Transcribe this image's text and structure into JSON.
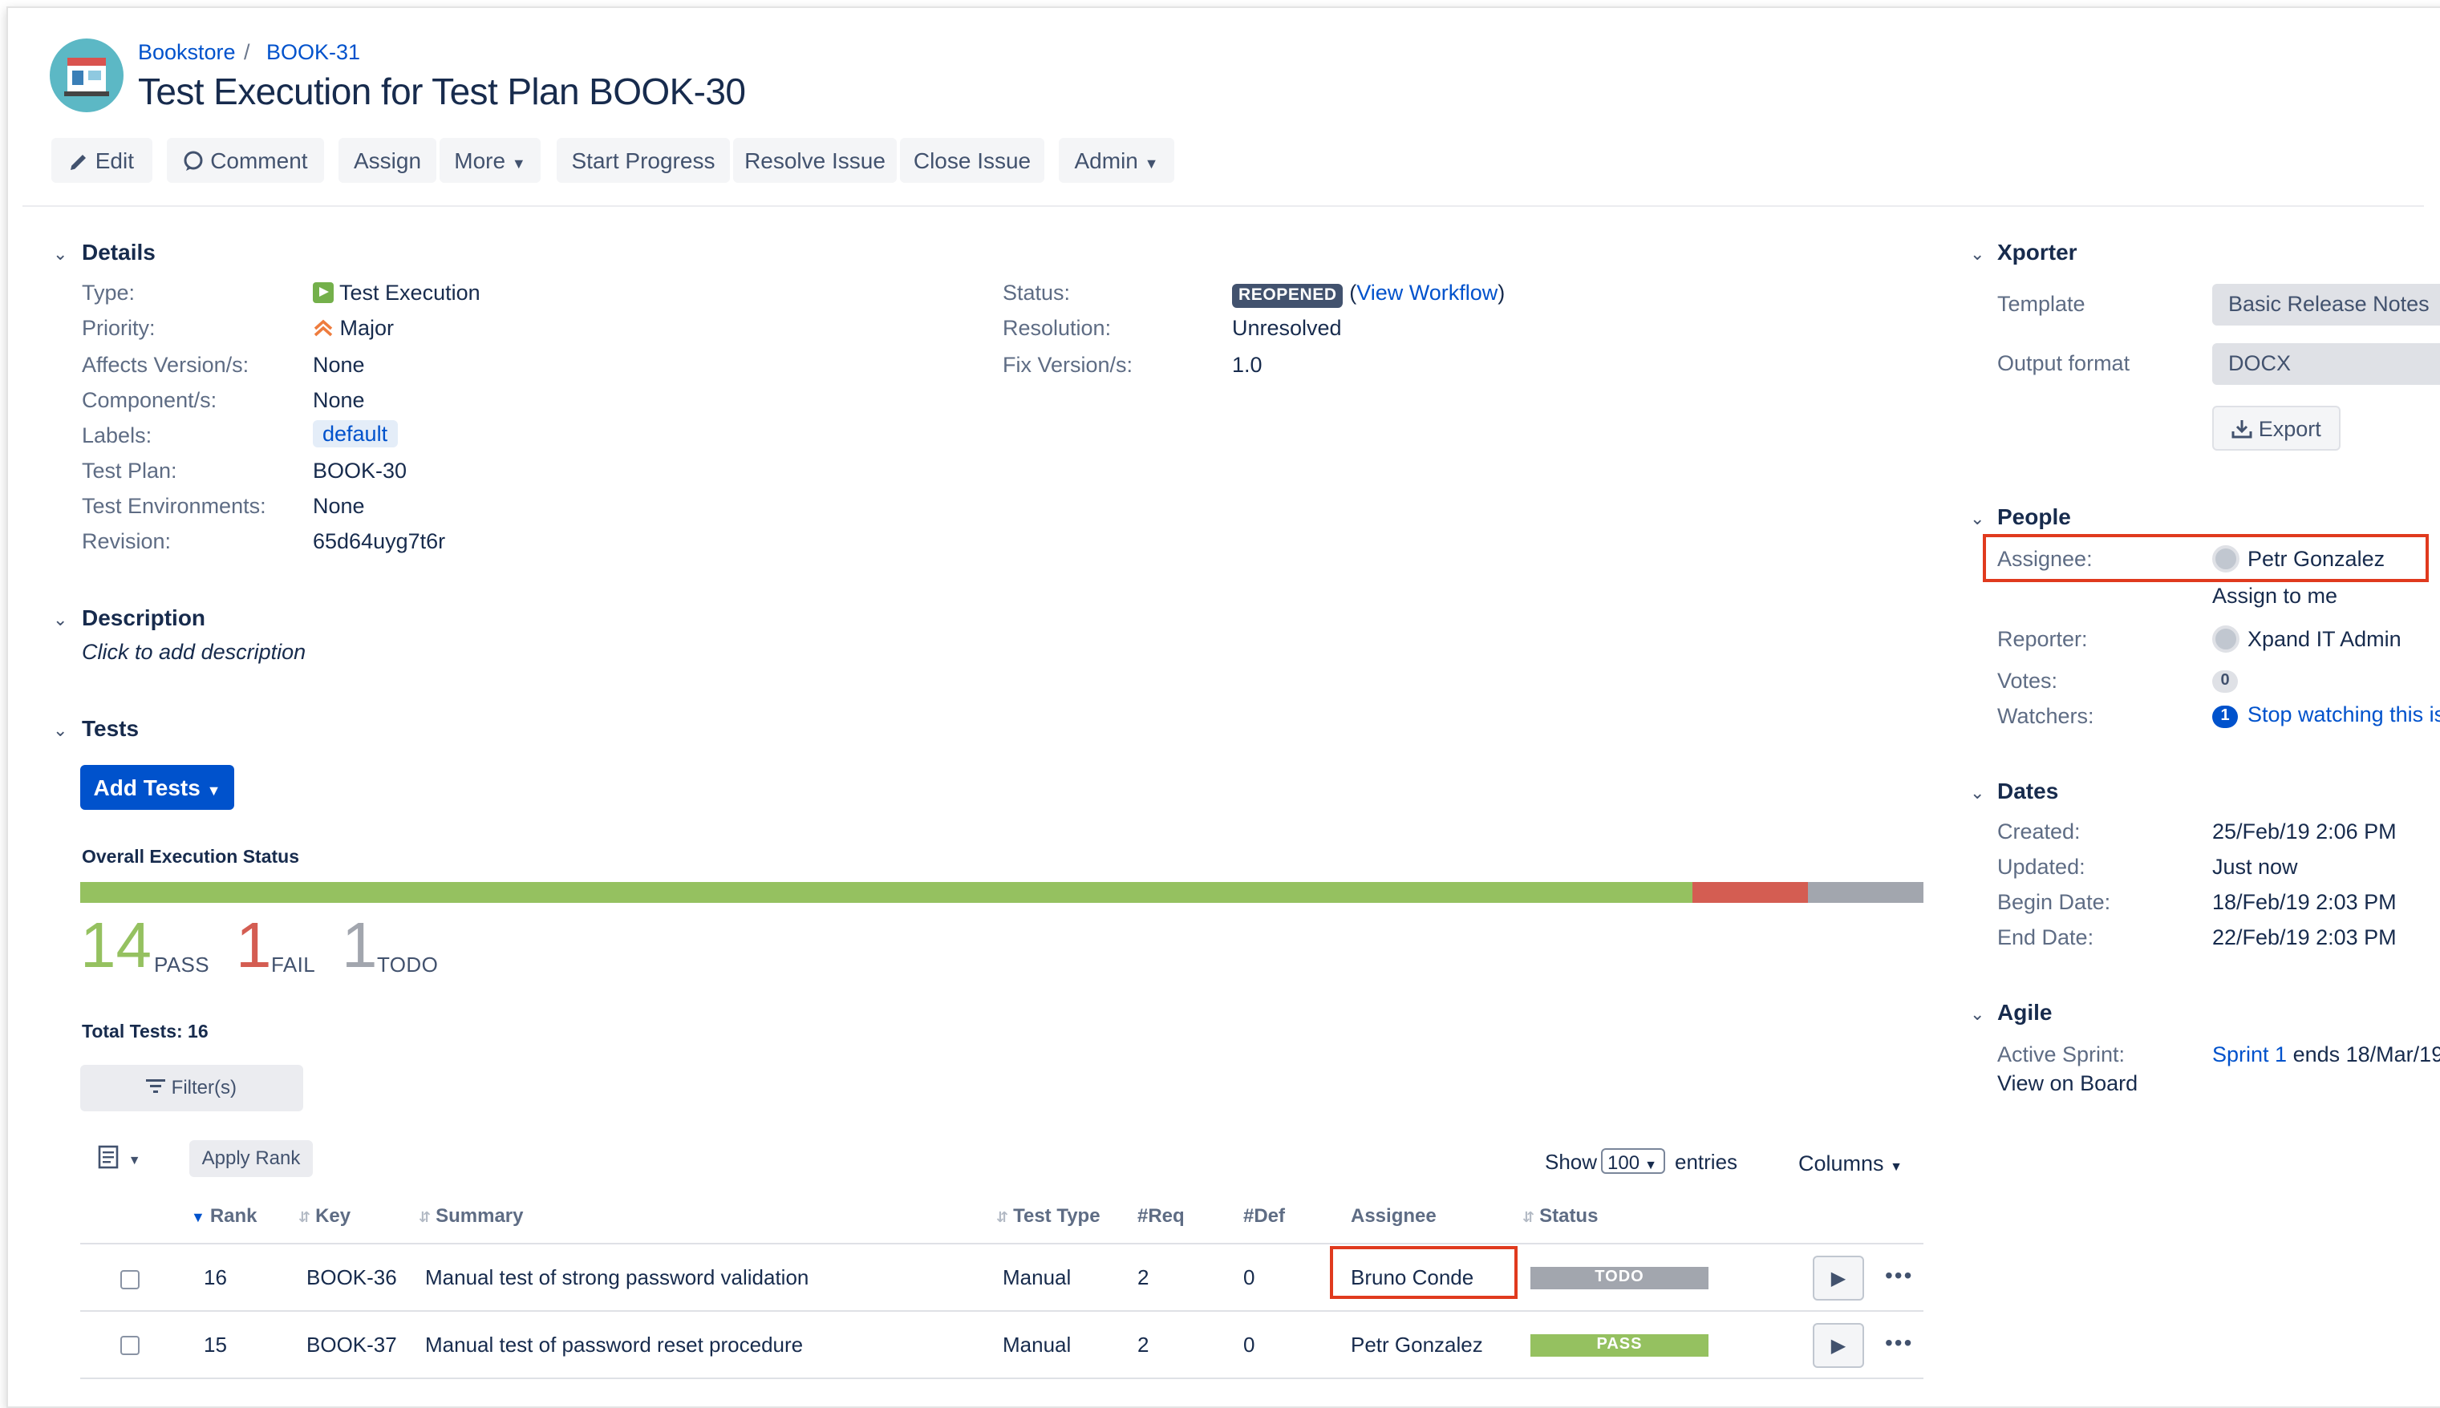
{
  "breadcrumb": {
    "project": "Bookstore",
    "separator": "/",
    "issue_key": "BOOK-31"
  },
  "issue": {
    "title": "Test Execution for Test Plan BOOK-30"
  },
  "toolbar": {
    "edit": "Edit",
    "comment": "Comment",
    "assign": "Assign",
    "more": "More",
    "start_progress": "Start Progress",
    "resolve_issue": "Resolve Issue",
    "close_issue": "Close Issue",
    "admin": "Admin"
  },
  "details": {
    "heading": "Details",
    "type_label": "Type:",
    "type_value": "Test Execution",
    "priority_label": "Priority:",
    "priority_value": "Major",
    "affects_label": "Affects Version/s:",
    "affects_value": "None",
    "component_label": "Component/s:",
    "component_value": "None",
    "labels_label": "Labels:",
    "labels_value": "default",
    "testplan_label": "Test Plan:",
    "testplan_value": "BOOK-30",
    "testenv_label": "Test Environments:",
    "testenv_value": "None",
    "revision_label": "Revision:",
    "revision_value": "65d64uyg7t6r",
    "status_label": "Status:",
    "status_value": "REOPENED",
    "view_workflow_open": "(",
    "view_workflow": "View Workflow",
    "view_workflow_close": ")",
    "resolution_label": "Resolution:",
    "resolution_value": "Unresolved",
    "fixversion_label": "Fix Version/s:",
    "fixversion_value": "1.0"
  },
  "description": {
    "heading": "Description",
    "placeholder": "Click to add description"
  },
  "tests": {
    "heading": "Tests",
    "add_tests": "Add Tests",
    "overall_label": "Overall Execution Status",
    "pass_count": "14",
    "pass_label": "PASS",
    "fail_count": "1",
    "fail_label": "FAIL",
    "todo_count": "1",
    "todo_label": "TODO",
    "total": "Total Tests: 16",
    "filters": "Filter(s)",
    "apply_rank": "Apply Rank",
    "show_label": "Show",
    "show_value": "100",
    "entries_label": "entries",
    "columns": "Columns",
    "headers": {
      "rank": "Rank",
      "key": "Key",
      "summary": "Summary",
      "test_type": "Test Type",
      "req": "#Req",
      "def": "#Def",
      "assignee": "Assignee",
      "status": "Status"
    },
    "rows": [
      {
        "rank": "16",
        "key": "BOOK-36",
        "summary": "Manual test of strong password validation",
        "test_type": "Manual",
        "req": "2",
        "def": "0",
        "assignee": "Bruno Conde",
        "status": "TODO"
      },
      {
        "rank": "15",
        "key": "BOOK-37",
        "summary": "Manual test of password reset procedure",
        "test_type": "Manual",
        "req": "2",
        "def": "0",
        "assignee": "Petr Gonzalez",
        "status": "PASS"
      }
    ]
  },
  "execution_status": {
    "pass_fraction": 0.875,
    "fail_fraction": 0.0625,
    "todo_fraction": 0.0625,
    "colors": {
      "pass": "#95c160",
      "fail": "#d45d52",
      "todo": "#a2a6ae"
    }
  },
  "xporter": {
    "heading": "Xporter",
    "template_label": "Template",
    "template_value": "Basic Release Notes",
    "format_label": "Output format",
    "format_value": "DOCX",
    "export": "Export"
  },
  "people": {
    "heading": "People",
    "assignee_label": "Assignee:",
    "assignee_value": "Petr Gonzalez",
    "assign_to_me": "Assign to me",
    "reporter_label": "Reporter:",
    "reporter_value": "Xpand IT Admin",
    "votes_label": "Votes:",
    "votes_value": "0",
    "watchers_label": "Watchers:",
    "watchers_value": "1",
    "stop_watching": "Stop watching this issue"
  },
  "dates": {
    "heading": "Dates",
    "created_label": "Created:",
    "created_value": "25/Feb/19 2:06 PM",
    "updated_label": "Updated:",
    "updated_value": "Just now",
    "begin_label": "Begin Date:",
    "begin_value": "18/Feb/19 2:03 PM",
    "end_label": "End Date:",
    "end_value": "22/Feb/19 2:03 PM"
  },
  "agile": {
    "heading": "Agile",
    "sprint_label": "Active Sprint:",
    "sprint_link": "Sprint 1",
    "sprint_suffix": "ends 18/Mar/19",
    "view_on_board": "View on Board"
  },
  "colors": {
    "link": "#0052cc",
    "primary": "#0052cc",
    "highlight": "#e03a1e",
    "todo_badge": "#a2a6ae",
    "pass_badge": "#95c160"
  }
}
